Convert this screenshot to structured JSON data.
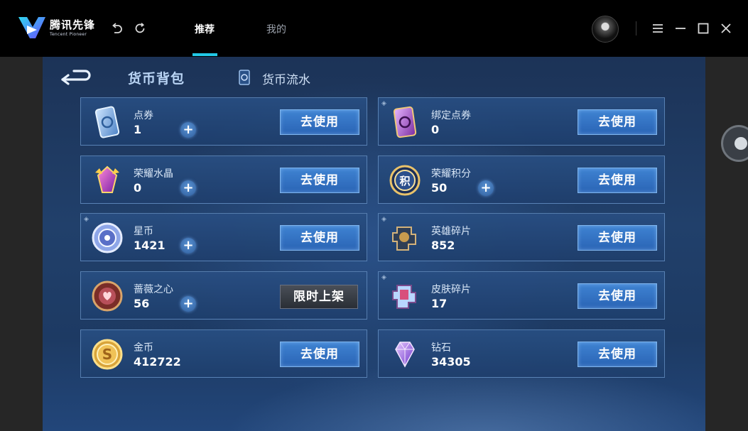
{
  "app": {
    "logo_text": "腾讯先锋",
    "logo_subtext": "Tencent Pioneer",
    "tabs": [
      {
        "label": "推荐",
        "active": true
      },
      {
        "label": "我的",
        "active": false
      }
    ],
    "accent_color": "#22c8e6"
  },
  "game": {
    "bag_title": "货币背包",
    "flow_label": "货币流水",
    "currencies": [
      {
        "name": "点券",
        "count": "1",
        "has_plus": true,
        "button": "去使用",
        "icon": "coupon-card-icon",
        "marked": false
      },
      {
        "name": "绑定点券",
        "count": "0",
        "has_plus": false,
        "button": "去使用",
        "icon": "bound-coupon-card-icon",
        "marked": true
      },
      {
        "name": "荣耀水晶",
        "count": "0",
        "has_plus": true,
        "button": "去使用",
        "icon": "glory-crystal-icon",
        "marked": false
      },
      {
        "name": "荣耀积分",
        "count": "50",
        "has_plus": true,
        "button": "去使用",
        "icon": "glory-points-icon",
        "marked": false
      },
      {
        "name": "星币",
        "count": "1421",
        "has_plus": true,
        "button": "去使用",
        "icon": "star-coin-icon",
        "marked": true
      },
      {
        "name": "英雄碎片",
        "count": "852",
        "has_plus": false,
        "button": "去使用",
        "icon": "hero-fragment-icon",
        "marked": true
      },
      {
        "name": "蔷薇之心",
        "count": "56",
        "has_plus": true,
        "button": "限时上架",
        "icon": "rose-heart-icon",
        "marked": false
      },
      {
        "name": "皮肤碎片",
        "count": "17",
        "has_plus": false,
        "button": "去使用",
        "icon": "skin-fragment-icon",
        "marked": true
      },
      {
        "name": "金币",
        "count": "412722",
        "has_plus": false,
        "button": "去使用",
        "icon": "gold-coin-icon",
        "marked": false
      },
      {
        "name": "钻石",
        "count": "34305",
        "has_plus": false,
        "button": "去使用",
        "icon": "diamond-icon",
        "marked": false
      }
    ]
  }
}
